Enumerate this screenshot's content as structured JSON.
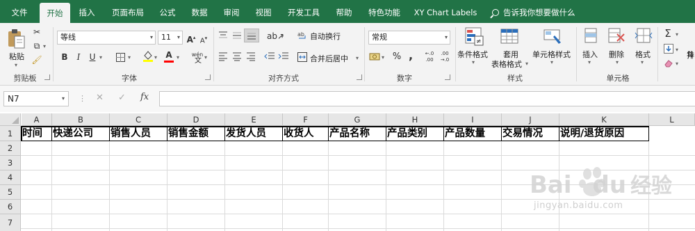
{
  "menubar": {
    "tabs": [
      {
        "label": "文件"
      },
      {
        "label": "开始"
      },
      {
        "label": "插入"
      },
      {
        "label": "页面布局"
      },
      {
        "label": "公式"
      },
      {
        "label": "数据"
      },
      {
        "label": "审阅"
      },
      {
        "label": "视图"
      },
      {
        "label": "开发工具"
      },
      {
        "label": "帮助"
      },
      {
        "label": "特色功能"
      },
      {
        "label": "XY Chart Labels"
      }
    ],
    "active_tab": "开始",
    "tell_me": "告诉我你想要做什么",
    "accent": "#217346"
  },
  "ribbon": {
    "clipboard": {
      "paste_label": "粘贴",
      "group_label": "剪贴板"
    },
    "font": {
      "font_name": "等线",
      "font_size": "11",
      "bold": "B",
      "italic": "I",
      "underline": "U",
      "grow": "A",
      "shrink": "A",
      "font_color": "A",
      "phonetic": "wén",
      "group_label": "字体",
      "font_color_hex": "#ff0000",
      "fill_color_hex": "#ffff00"
    },
    "alignment": {
      "wrap_text": "自动换行",
      "merge_center": "合并后居中",
      "group_label": "对齐方式"
    },
    "number": {
      "format": "常规",
      "percent": "%",
      "comma": ",",
      "group_label": "数字"
    },
    "styles": {
      "conditional": "条件格式",
      "table_format_1": "套用",
      "table_format_2": "表格格式",
      "cell_styles": "单元格样式",
      "group_label": "样式"
    },
    "cells": {
      "insert": "插入",
      "delete": "删除",
      "format": "格式",
      "group_label": "单元格"
    },
    "editing": {
      "sort_label": "排"
    }
  },
  "formula_bar": {
    "name_box": "N7",
    "fx_label": "fx",
    "formula": ""
  },
  "sheet": {
    "columns": [
      "A",
      "B",
      "C",
      "D",
      "E",
      "F",
      "G",
      "H",
      "I",
      "J",
      "K",
      "L"
    ],
    "rows": [
      "1",
      "2",
      "3",
      "4",
      "5",
      "6",
      "7"
    ],
    "headers": [
      "时间",
      "快递公司",
      "销售人员",
      "销售金额",
      "发货人员",
      "收货人",
      "产品名称",
      "产品类别",
      "产品数量",
      "交易情况",
      "说明/退货原因"
    ]
  },
  "watermark": {
    "brand": "Bai",
    "brand2": "du",
    "brand_cn": "经验",
    "url": "jingyan.baidu.com"
  }
}
